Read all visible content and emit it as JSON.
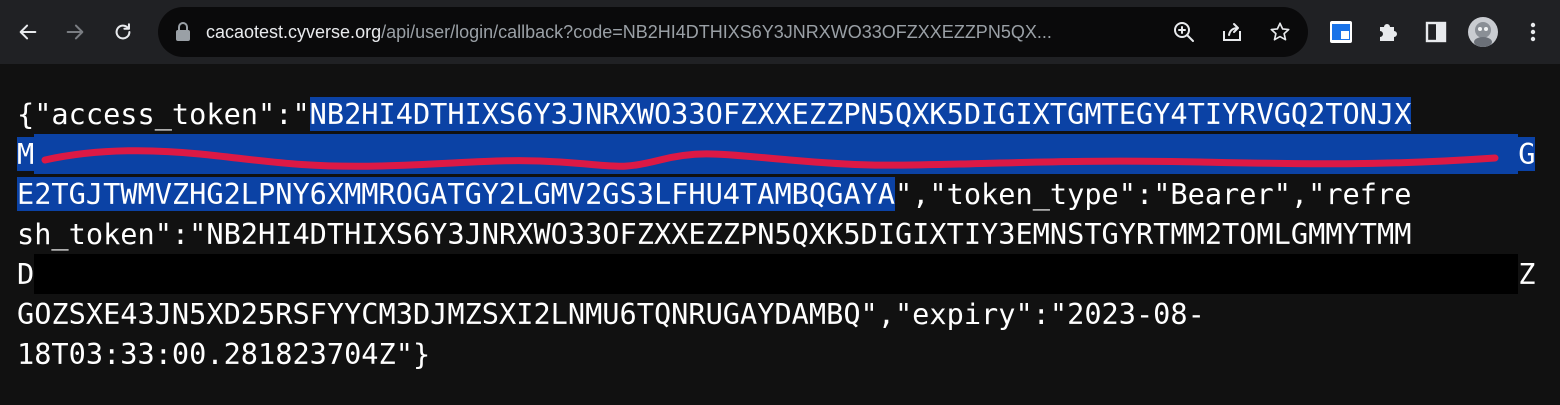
{
  "browser": {
    "url_host": "cacaotest.cyverse.org",
    "url_path": "/api/user/login/callback?code=NB2HI4DTHIXS6Y3JNRXWO33OFZXXEZZPN5QX...",
    "icons": [
      "back-icon",
      "forward-icon",
      "reload-icon",
      "lock-icon",
      "zoom-icon",
      "share-icon",
      "bookmark-star-icon",
      "extension-icon",
      "puzzle-icon",
      "side-panel-icon",
      "profile-avatar",
      "menu-kebab-icon"
    ]
  },
  "json_lines": {
    "line1_a": "{\"access_token\":\"",
    "line1_b": "NB2HI4DTHIXS6Y3JNRXWO33OFZXXEZZPN5QXK5DIGIXTGMTEGY4TIYRVGQ2TONJX",
    "line2_a": "M",
    "line2_b": "G",
    "line3_a": "E2TGJTWMVZHG2LPNY6XMMROGATGY2LGMV2GS3LFHU4TAMBQGAYA",
    "line3_b": "\",\"token_type\":\"Bearer\",\"refre",
    "line4": "sh_token\":\"NB2HI4DTHIXS6Y3JNRXWO33OFZXXEZZPN5QXK5DIGIXTIY3EMNSTGYRTMM2TOMLGMMYTMM",
    "line5_a": "D",
    "line5_b": "Z",
    "line6": "GOZSXE43JN5XD25RSFYYCM3DJMZSXI2LNMU6TQNRUGAYDAMBQ\",\"expiry\":\"2023-08-",
    "line7": "18T03:33:00.281823704Z\"}"
  },
  "colors": {
    "toolbar": "#202124",
    "omnibox": "#0a0a0b",
    "page": "#111111",
    "selection": "#0b42a5",
    "scribble": "#e8173f"
  }
}
